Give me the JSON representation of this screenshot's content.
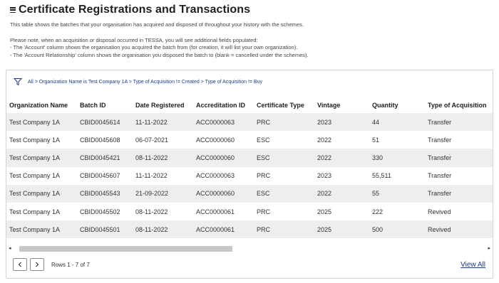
{
  "header": {
    "title": "Certificate Registrations and Transactions",
    "description": "This table shows the batches that your organisation has acquired and disposed of throughout your history with the schemes.",
    "note_lines": [
      "Please note, when an acquisition or disposal occurred in TESSA, you will see additional fields populated:",
      "- The 'Account' column shows the organisation you acquired the batch from (for creation, it will list your own organization).",
      "- The 'Account Relationship' column shows the organisation you disposed the batch to (blank = cancelled under the schemes)."
    ]
  },
  "filter": {
    "icon": "filter-icon",
    "text": "All > Organization Name is Test Company 1A > Type of Acquisition != Created > Type of Acquisition != Buy"
  },
  "table": {
    "columns": [
      "Organization Name",
      "Batch ID",
      "Date Registered",
      "Accreditation ID",
      "Certificate Type",
      "Vintage",
      "Quantity",
      "Type of Acquisition"
    ],
    "rows": [
      [
        "Test Company 1A",
        "CBID0045614",
        "11-11-2022",
        "ACC0000063",
        "PRC",
        "2023",
        "44",
        "Transfer"
      ],
      [
        "Test Company 1A",
        "CBID0045608",
        "06-07-2021",
        "ACC0000060",
        "ESC",
        "2022",
        "51",
        "Transfer"
      ],
      [
        "Test Company 1A",
        "CBID0045421",
        "08-11-2022",
        "ACC0000060",
        "ESC",
        "2022",
        "330",
        "Transfer"
      ],
      [
        "Test Company 1A",
        "CBID0045607",
        "11-11-2022",
        "ACC0000063",
        "PRC",
        "2023",
        "55,511",
        "Transfer"
      ],
      [
        "Test Company 1A",
        "CBID0045543",
        "21-09-2022",
        "ACC0000060",
        "ESC",
        "2022",
        "55",
        "Transfer"
      ],
      [
        "Test Company 1A",
        "CBID0045502",
        "08-11-2022",
        "ACC0000061",
        "PRC",
        "2025",
        "222",
        "Revived"
      ],
      [
        "Test Company 1A",
        "CBID0045501",
        "08-11-2022",
        "ACC0000061",
        "PRC",
        "2025",
        "500",
        "Revived"
      ]
    ]
  },
  "scrollbar": {
    "left_arrow": "◂",
    "right_arrow": "▸"
  },
  "pagination": {
    "prev_icon": "chevron-left-icon",
    "next_icon": "chevron-right-icon",
    "rows_text": "Rows 1 - 7 of 7"
  },
  "view_all": "View All"
}
